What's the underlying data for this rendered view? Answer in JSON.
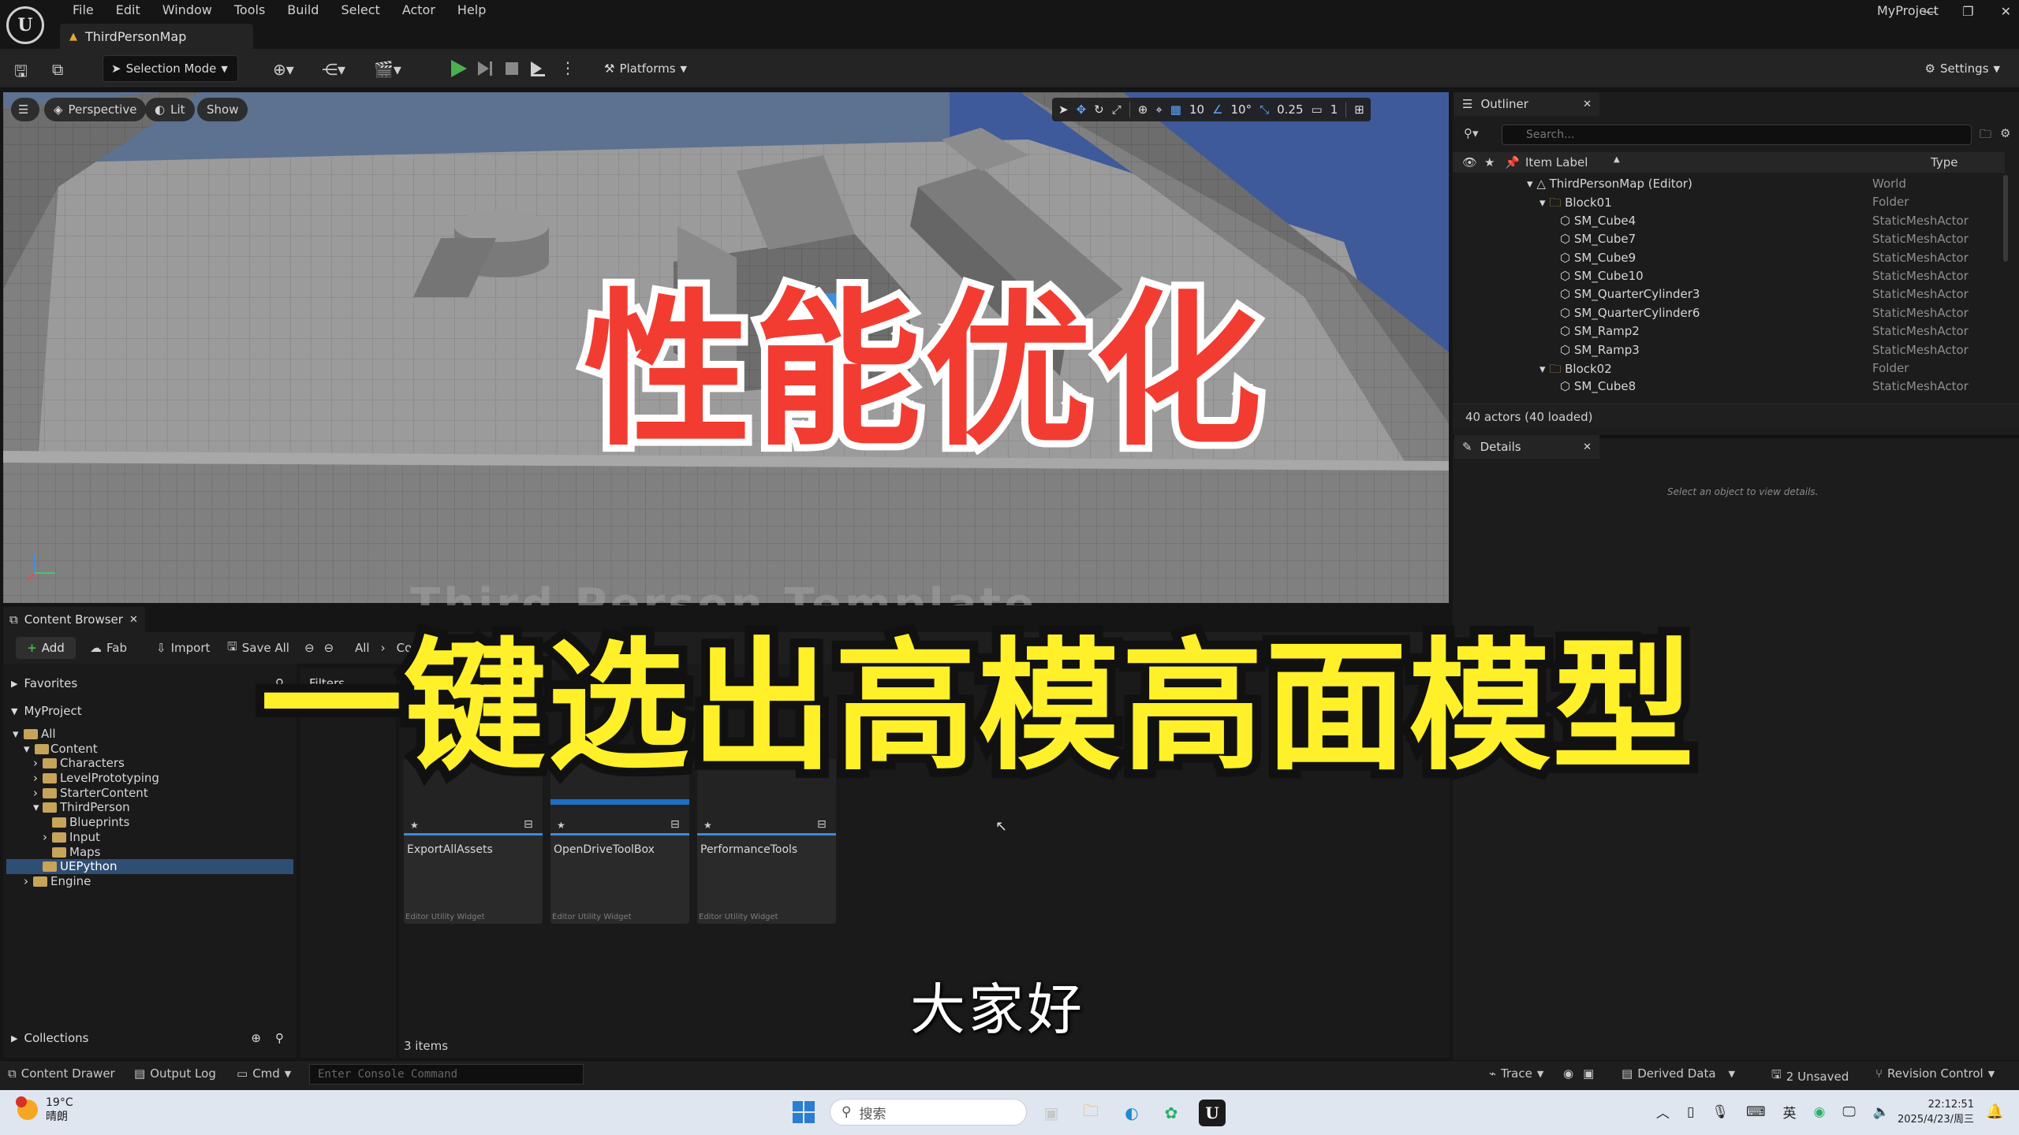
{
  "titlebar": {
    "menu": [
      "File",
      "Edit",
      "Window",
      "Tools",
      "Build",
      "Select",
      "Actor",
      "Help"
    ],
    "map_tab": "ThirdPersonMap",
    "project": "MyProject"
  },
  "toolbar": {
    "selection_mode": "Selection Mode",
    "platforms": "Platforms",
    "settings": "Settings"
  },
  "viewport": {
    "perspective": "Perspective",
    "lit": "Lit",
    "show": "Show",
    "grid_snap": "10",
    "rotation_snap": "10°",
    "scale_snap": "0.25",
    "camera_speed": "1",
    "overlay_title": "性能优化",
    "background_text": "Third Person Template"
  },
  "outliner": {
    "tab": "Outliner",
    "search_placeholder": "Search...",
    "col_label": "Item Label",
    "col_type": "Type",
    "rows": [
      {
        "label": "ThirdPersonMap (Editor)",
        "type": "World"
      },
      {
        "label": "Block01",
        "type": "Folder"
      },
      {
        "label": "SM_Cube4",
        "type": "StaticMeshActor"
      },
      {
        "label": "SM_Cube7",
        "type": "StaticMeshActor"
      },
      {
        "label": "SM_Cube9",
        "type": "StaticMeshActor"
      },
      {
        "label": "SM_Cube10",
        "type": "StaticMeshActor"
      },
      {
        "label": "SM_QuarterCylinder3",
        "type": "StaticMeshActor"
      },
      {
        "label": "SM_QuarterCylinder6",
        "type": "StaticMeshActor"
      },
      {
        "label": "SM_Ramp2",
        "type": "StaticMeshActor"
      },
      {
        "label": "SM_Ramp3",
        "type": "StaticMeshActor"
      },
      {
        "label": "Block02",
        "type": "Folder"
      },
      {
        "label": "SM_Cube8",
        "type": "StaticMeshActor"
      }
    ],
    "status": "40 actors (40 loaded)"
  },
  "details": {
    "tab": "Details",
    "hint": "Select an object to view details."
  },
  "content_browser": {
    "tab": "Content Browser",
    "add": "Add",
    "fab": "Fab",
    "import": "Import",
    "save_all": "Save All",
    "path_all": "All",
    "path_co": "Co",
    "favorites": "Favorites",
    "project": "MyProject",
    "filters": "Filters",
    "collections": "Collections",
    "folders": [
      {
        "label": "All",
        "depth": 0
      },
      {
        "label": "Content",
        "depth": 1
      },
      {
        "label": "Characters",
        "depth": 2
      },
      {
        "label": "LevelPrototyping",
        "depth": 2
      },
      {
        "label": "StarterContent",
        "depth": 2
      },
      {
        "label": "ThirdPerson",
        "depth": 2
      },
      {
        "label": "Blueprints",
        "depth": 3
      },
      {
        "label": "Input",
        "depth": 3
      },
      {
        "label": "Maps",
        "depth": 3
      },
      {
        "label": "UEPython",
        "depth": 2
      },
      {
        "label": "Engine",
        "depth": 1
      }
    ],
    "assets": [
      {
        "name": "ExportAllAssets",
        "kind": "Editor Utility Widget"
      },
      {
        "name": "OpenDriveToolBox",
        "kind": "Editor Utility Widget"
      },
      {
        "name": "PerformanceTools",
        "kind": "Editor Utility Widget"
      }
    ],
    "item_count": "3 items",
    "overlay_title": "一键选出高模高面模型",
    "subtitle": "大家好"
  },
  "statusbar": {
    "content_drawer": "Content Drawer",
    "output_log": "Output Log",
    "cmd": "Cmd",
    "console_placeholder": "Enter Console Command",
    "trace": "Trace",
    "derived_data": "Derived Data",
    "unsaved": "2 Unsaved",
    "revision_control": "Revision Control"
  },
  "taskbar": {
    "temperature": "19°C",
    "weather": "晴朗",
    "search": "搜索",
    "ime": "英",
    "time": "22:12:51",
    "date": "2025/4/23/周三"
  },
  "colors": {
    "accent_blue": "#3b8bd9",
    "overlay_red": "#f23c32",
    "overlay_yellow": "#fff02a",
    "play_green": "#4caf50"
  }
}
